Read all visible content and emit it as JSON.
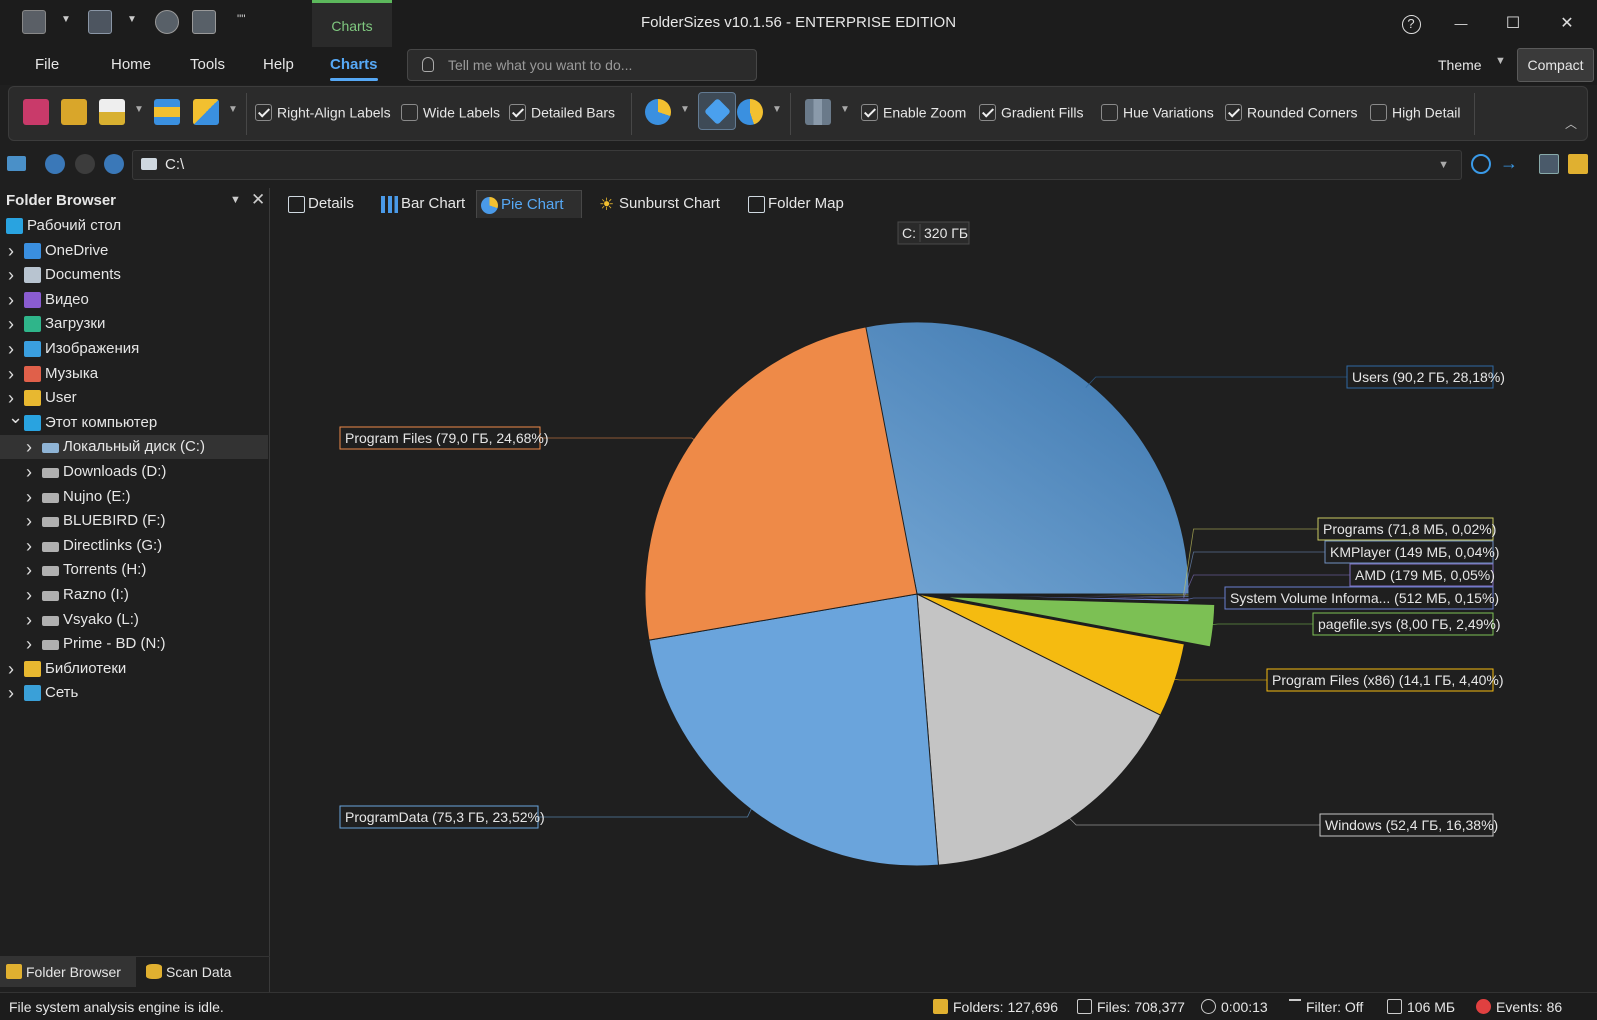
{
  "titlebar": {
    "title": "FolderSizes v10.1.56 - ENTERPRISE EDITION",
    "context_tab": "Charts",
    "help_glyph": "?",
    "minimize_glyph": "—",
    "maximize_glyph": "☐",
    "close_glyph": "✕",
    "more_glyph": "\"\""
  },
  "ribbon_tabs": {
    "items": [
      "File",
      "Home",
      "Tools",
      "Help",
      "Charts"
    ],
    "active": "Charts",
    "tellme_placeholder": "Tell me what you want to do...",
    "theme_label": "Theme",
    "compact_label": "Compact"
  },
  "ribbon": {
    "checkboxes": [
      {
        "label": "Right-Align Labels",
        "checked": true
      },
      {
        "label": "Wide Labels",
        "checked": false
      },
      {
        "label": "Detailed Bars",
        "checked": true
      },
      {
        "label": "Enable Zoom",
        "checked": true
      },
      {
        "label": "Gradient Fills",
        "checked": true
      },
      {
        "label": "Hue Variations",
        "checked": false
      },
      {
        "label": "Rounded Corners",
        "checked": true
      },
      {
        "label": "High Detail",
        "checked": false
      }
    ],
    "icons": [
      "save-icon",
      "clipboard-icon",
      "export-icon",
      "measure-icon",
      "palette-icon",
      "pie-icon",
      "tag-icon",
      "pie-slice-icon",
      "map-icon"
    ]
  },
  "address": {
    "path": "C:\\"
  },
  "sidebar": {
    "title": "Folder Browser",
    "tree": [
      {
        "label": "Рабочий стол",
        "level": 0,
        "chevron": "",
        "icon_color": "#29a3e0"
      },
      {
        "label": "OneDrive",
        "level": 1,
        "chevron": ">",
        "icon_color": "#3a8fe0"
      },
      {
        "label": "Documents",
        "level": 1,
        "chevron": ">",
        "icon_color": "#b8c4d0"
      },
      {
        "label": "Видео",
        "level": 1,
        "chevron": ">",
        "icon_color": "#8a5cd0"
      },
      {
        "label": "Загрузки",
        "level": 1,
        "chevron": ">",
        "icon_color": "#2fb58a"
      },
      {
        "label": "Изображения",
        "level": 1,
        "chevron": ">",
        "icon_color": "#3a9fe0"
      },
      {
        "label": "Музыка",
        "level": 1,
        "chevron": ">",
        "icon_color": "#e0604a"
      },
      {
        "label": "User",
        "level": 1,
        "chevron": ">",
        "icon_color": "#e8b830"
      },
      {
        "label": "Этот компьютер",
        "level": 1,
        "chevron": "v",
        "icon_color": "#29a3e0"
      },
      {
        "label": "Локальный диск (C:)",
        "level": 2,
        "chevron": ">",
        "icon_color": "#8fb4d6",
        "selected": true
      },
      {
        "label": "Downloads (D:)",
        "level": 2,
        "chevron": ">",
        "icon_color": "#b0b0b0"
      },
      {
        "label": "Nujno (E:)",
        "level": 2,
        "chevron": ">",
        "icon_color": "#b0b0b0"
      },
      {
        "label": "BLUEBIRD (F:)",
        "level": 2,
        "chevron": ">",
        "icon_color": "#b0b0b0"
      },
      {
        "label": "Directlinks (G:)",
        "level": 2,
        "chevron": ">",
        "icon_color": "#b0b0b0"
      },
      {
        "label": "Torrents (H:)",
        "level": 2,
        "chevron": ">",
        "icon_color": "#b0b0b0"
      },
      {
        "label": "Razno (I:)",
        "level": 2,
        "chevron": ">",
        "icon_color": "#b0b0b0"
      },
      {
        "label": "Vsyako (L:)",
        "level": 2,
        "chevron": ">",
        "icon_color": "#b0b0b0"
      },
      {
        "label": "Prime - BD (N:)",
        "level": 2,
        "chevron": ">",
        "icon_color": "#b0b0b0"
      },
      {
        "label": "Библиотеки",
        "level": 1,
        "chevron": ">",
        "icon_color": "#e8b830"
      },
      {
        "label": "Сеть",
        "level": 1,
        "chevron": ">",
        "icon_color": "#3aa0d8"
      }
    ],
    "bottom_tabs": [
      "Folder Browser",
      "Scan Data"
    ]
  },
  "view_tabs": {
    "items": [
      "Details",
      "Bar Chart",
      "Pie Chart",
      "Sunburst Chart",
      "Folder Map"
    ],
    "active": "Pie Chart"
  },
  "chart_data": {
    "type": "pie",
    "title": "C:  320 ГБ",
    "title_drive": "C:",
    "title_size": "320 ГБ",
    "slices": [
      {
        "name": "Users",
        "size": "90,2 ГБ",
        "percent": 28.18,
        "label": "Users (90,2 ГБ, 28,18%)",
        "color": "#4a86c0",
        "light": "#7fb0dc",
        "dark": "#2f6aa4"
      },
      {
        "name": "Programs",
        "size": "71,8 МБ",
        "percent": 0.02,
        "label": "Programs (71,8 МБ, 0,02%)",
        "color": "#c8c860"
      },
      {
        "name": "KMPlayer",
        "size": "149 МБ",
        "percent": 0.04,
        "label": "KMPlayer (149 МБ, 0,04%)",
        "color": "#7090c0"
      },
      {
        "name": "AMD",
        "size": "179 МБ",
        "percent": 0.05,
        "label": "AMD (179 МБ, 0,05%)",
        "color": "#8070c0"
      },
      {
        "name": "System Volume Informa...",
        "size": "512 МБ",
        "percent": 0.15,
        "label": "System Volume Informa... (512 МБ, 0,15%)",
        "color": "#6a7fd0"
      },
      {
        "name": "pagefile.sys",
        "size": "8,00 ГБ",
        "percent": 2.49,
        "label": "pagefile.sys (8,00 ГБ, 2,49%)",
        "color": "#7cc054",
        "exploded": true
      },
      {
        "name": "Program Files (x86)",
        "size": "14,1 ГБ",
        "percent": 4.4,
        "label": "Program Files (x86) (14,1 ГБ, 4,40%)",
        "color": "#f5bb10"
      },
      {
        "name": "Windows",
        "size": "52,4 ГБ",
        "percent": 16.38,
        "label": "Windows (52,4 ГБ, 16,38%)",
        "color": "#c4c4c4"
      },
      {
        "name": "ProgramData",
        "size": "75,3 ГБ",
        "percent": 23.52,
        "label": "ProgramData (75,3 ГБ, 23,52%)",
        "color": "#6aa4dc"
      },
      {
        "name": "Program Files",
        "size": "79,0 ГБ",
        "percent": 24.68,
        "label": "Program Files (79,0 ГБ, 24,68%)",
        "color": "#ee8a48"
      }
    ],
    "legend": "outside labels with leader lines"
  },
  "status": {
    "left": "File system analysis engine is idle.",
    "folders": "Folders: 127,696",
    "files": "Files: 708,377",
    "time": "0:00:13",
    "filter": "Filter: Off",
    "memory": "106 МБ",
    "events": "Events: 86"
  }
}
